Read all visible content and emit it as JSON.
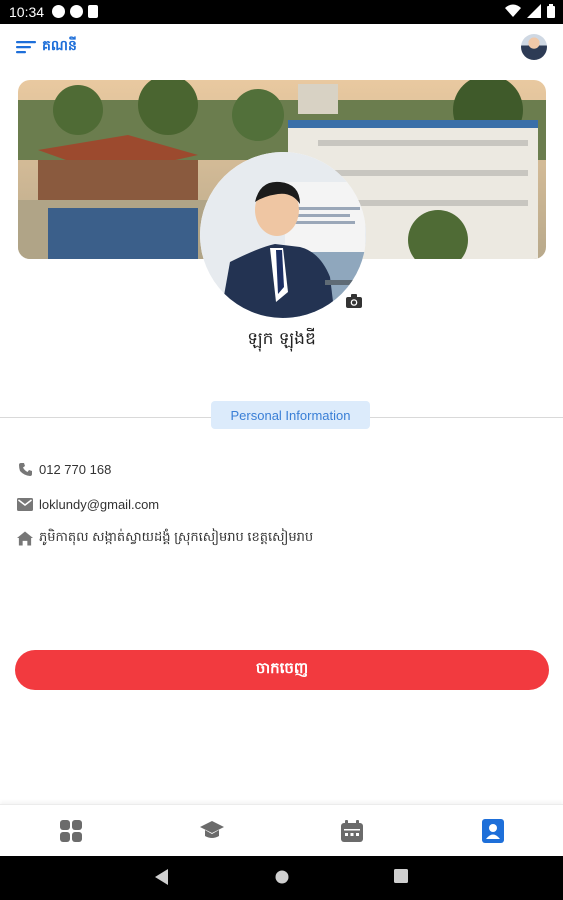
{
  "status_bar": {
    "time": "10:34",
    "icons": [
      "app-icon-a",
      "app-icon-p",
      "sd-card-icon"
    ],
    "right_icons": [
      "wifi-icon",
      "signal-icon",
      "battery-icon"
    ]
  },
  "app_bar": {
    "menu_label": "គណនី",
    "menu_icon": "menu-lines-icon",
    "avatar_icon": "avatar"
  },
  "profile": {
    "name": "ឡុក ឡុងឌី",
    "camera_icon": "camera-icon"
  },
  "section": {
    "title": "Personal Information"
  },
  "info": {
    "phone": "012 770 168",
    "email": "loklundy@gmail.com",
    "address": "ភូមិកាតុល សង្កាត់ស្វាយដង្គំ ស្រុកសៀមរាប ខេត្តសៀមរាប"
  },
  "actions": {
    "logout_label": "ចាកចេញ"
  },
  "bottom_nav": {
    "items": [
      "dashboard-icon",
      "school-icon",
      "calendar-icon",
      "profile-icon"
    ],
    "active_index": 3
  },
  "colors": {
    "accent": "#1e6fd9",
    "danger": "#f23a3f",
    "chip_bg": "#dcebfb"
  }
}
